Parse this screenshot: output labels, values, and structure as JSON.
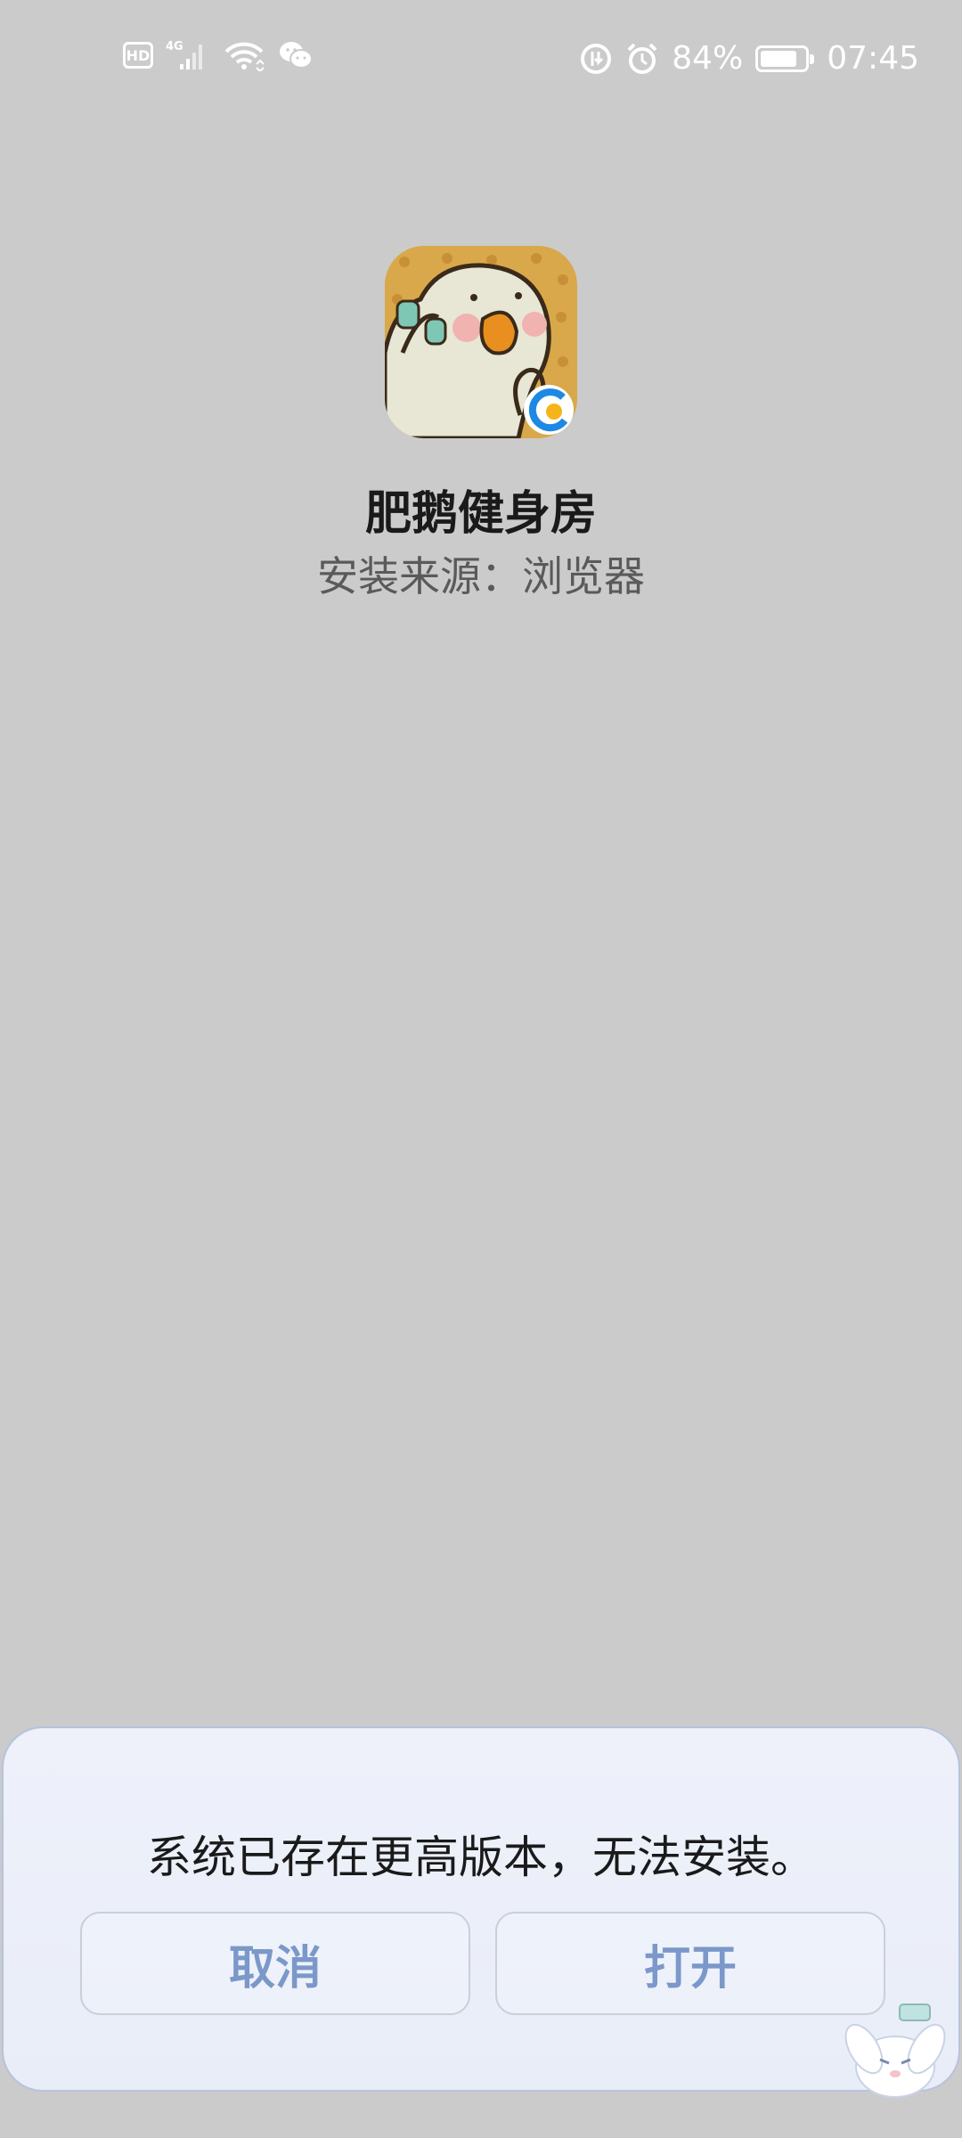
{
  "status_bar": {
    "hd": "HD",
    "network": "4G",
    "battery_percent": "84%",
    "battery_level": 0.84,
    "time": "07:45",
    "icons": [
      "hd-icon",
      "signal-4g-icon",
      "wifi-icon",
      "wechat-icon",
      "data-saver-icon",
      "alarm-icon",
      "battery-icon"
    ]
  },
  "app": {
    "name": "肥鹅健身房",
    "install_source": "安装来源：浏览器",
    "icon": "goose-app-icon",
    "badge": "browser-badge-icon"
  },
  "dialog": {
    "message": "系统已存在更高版本，无法安装。",
    "cancel_label": "取消",
    "open_label": "打开"
  },
  "colors": {
    "background": "#cbcbcb",
    "dialog_bg": "#eef1fa",
    "button_text": "#7b98c9",
    "icon_bg": "#d9a84a",
    "browser_badge": "#1e88e5"
  }
}
